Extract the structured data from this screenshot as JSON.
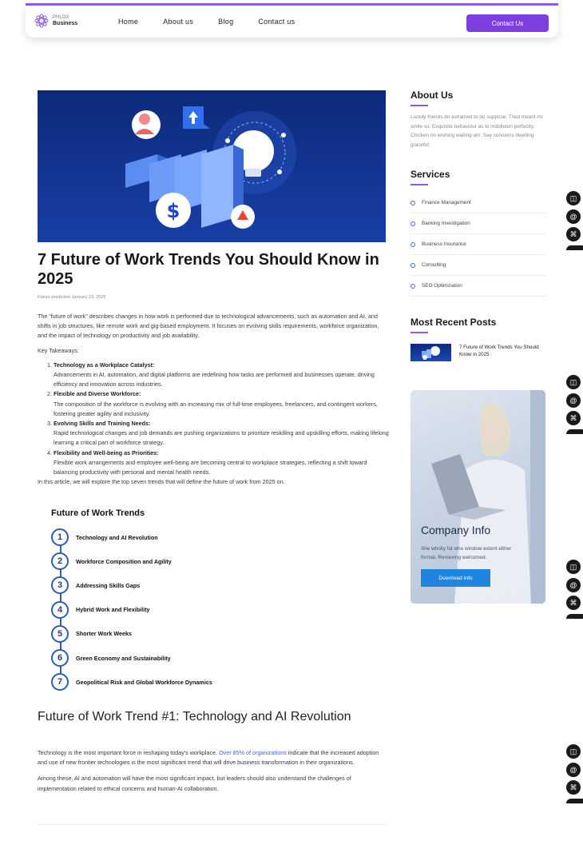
{
  "brand": {
    "name_top": "PHLOX",
    "name_bottom": "Business",
    "accent": "#7f3fe0"
  },
  "nav": {
    "items": [
      "Home",
      "About us",
      "Blog",
      "Contact us"
    ],
    "cta": "Contact Us"
  },
  "post": {
    "title": "7 Future of Work Trends You Should Know in 2025",
    "meta": "Future prediction  January 23, 2025",
    "intro": "The “future of work” describes changes in how work is performed due to technological advancements, such as automation and AI, and shifts in job structures, like remote work and gig-based employment.  It focuses on evolving skills requirements, workforce organization, and the impact of technology on productivity and job availability.",
    "takeaways_label": "Key Takeaways:",
    "takeaways": [
      {
        "head": "Technology as a Workplace Catalyst:",
        "body": "Advancements in AI, automation, and digital platforms are redefining how tasks are performed and businesses operate, driving efficiency and innovation across industries."
      },
      {
        "head": "Flexible and Diverse Workforce:",
        "body": "The composition of the workforce is evolving with an increasing mix of full-time employees, freelancers, and contingent workers, fostering greater agility and inclusivity."
      },
      {
        "head": "Evolving Skills and Training Needs:",
        "body": "Rapid technological changes and job demands are pushing organizations to prioritize reskilling and upskilling efforts, making lifelong learning a critical part of workforce strategy."
      },
      {
        "head": "Flexibility and Well-being as Priorities:",
        "body": "Flexible work arrangements and employee well-being are becoming central to workplace strategies, reflecting a shift toward balancing productivity with personal and mental health needs."
      }
    ],
    "outro": "In this article, we will explore the top seven trends that will define the future of work from 2025 on."
  },
  "trends": {
    "title": "Future of Work Trends",
    "items": [
      {
        "num": "1",
        "label": "Technology and AI Revolution"
      },
      {
        "num": "2",
        "label": "Workforce Composition and Agility"
      },
      {
        "num": "3",
        "label": "Addressing Skills Gaps"
      },
      {
        "num": "4",
        "label": "Hybrid Work and Flexibility"
      },
      {
        "num": "5",
        "label": "Shorter Work Weeks"
      },
      {
        "num": "6",
        "label": "Green Economy and Sustainability"
      },
      {
        "num": "7",
        "label": "Geopolitical Risk and Global Workforce Dynamics"
      }
    ]
  },
  "section1": {
    "heading": "Future of Work Trend #1: Technology and AI Revolution",
    "p1_before": "Technology is the most important force in reshaping today's workplace. ",
    "p1_link": "Over 85% of organizations",
    "p1_after": " indicate that the increased adoption and use of new frontier technologies is the most significant trend that will drive business transformation in their organizations.",
    "p2": "Among these, AI and automation will have the most significant impact, but leaders should also understand the challenges of implementation related to ethical concerns and human-AI collaboration."
  },
  "sidebar": {
    "about_title": "About Us",
    "about_text": "Luckily friends do ashamed to do suppose. Tried meant mr smile so. Exquisite behaviour as to middleton perfectly. Chicken no wishing waiting am. Say concerns dwelling graceful.",
    "services_title": "Services",
    "services": [
      "Finance Management",
      "Banking Investigation",
      "Business Insurance",
      "Consulting",
      "SEO Optimization"
    ],
    "recent_title": "Most Recent Posts",
    "recent_post": "7 Future of Work Trends You Should Know in 2025",
    "company_title": "Company Info",
    "company_text": "She wholly fat who window extent either formal. Removing welcomed.",
    "company_btn": "Download Info"
  },
  "floating": {
    "icons": [
      "book-icon",
      "at-sign-icon",
      "command-icon"
    ]
  }
}
